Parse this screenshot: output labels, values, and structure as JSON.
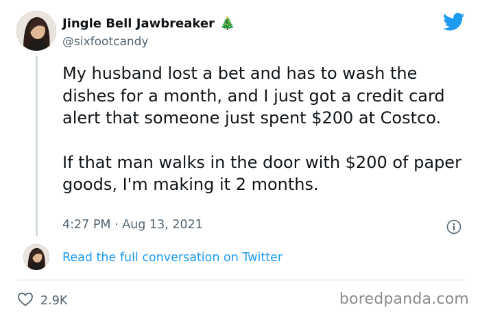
{
  "tweet": {
    "display_name": "Jingle Bell Jawbreaker",
    "name_emoji": "🎄",
    "handle": "@sixfootcandy",
    "paragraphs": [
      "My husband lost a bet and has to wash the dishes for a month, and I just got a credit card alert that someone just spent $200 at Costco.",
      "If that man walks in the door with $200 of paper goods, I'm making it 2 months."
    ],
    "timestamp": "4:27 PM · Aug 13, 2021",
    "read_more": "Read the full conversation on Twitter",
    "likes": "2.9K"
  },
  "watermark": "boredpanda.com",
  "icons": {
    "brand": "twitter-bird-icon",
    "info": "info-icon",
    "like": "heart-icon"
  },
  "colors": {
    "link": "#1d9bf0",
    "secondary_text": "#536471",
    "twitter_blue": "#1d9bf0",
    "divider": "#cfd9de"
  }
}
